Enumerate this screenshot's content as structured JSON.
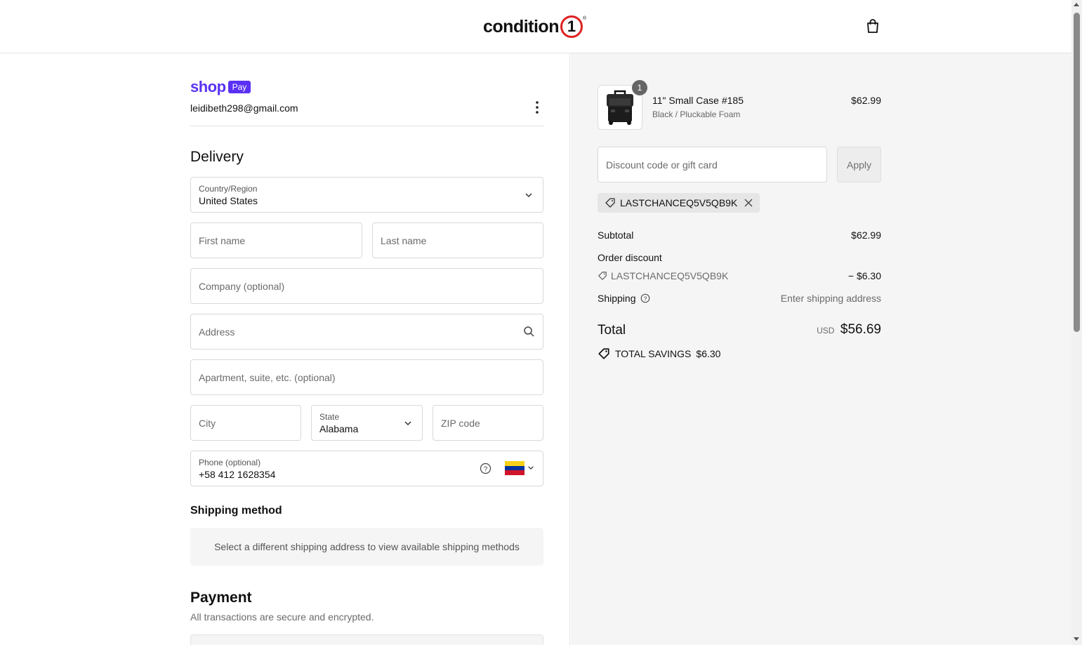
{
  "header": {
    "logo_text": "condition",
    "logo_number": "1",
    "logo_reg": "®",
    "cart_icon": "shopping-bag-icon"
  },
  "express": {
    "shop_word": "shop",
    "pay_badge": "Pay",
    "email": "leidibeth298@gmail.com",
    "menu_icon": "kebab-menu-icon"
  },
  "delivery": {
    "heading": "Delivery",
    "country_label": "Country/Region",
    "country_value": "United States",
    "first_name_placeholder": "First name",
    "last_name_placeholder": "Last name",
    "company_placeholder": "Company (optional)",
    "address_placeholder": "Address",
    "apartment_placeholder": "Apartment, suite, etc. (optional)",
    "city_placeholder": "City",
    "state_label": "State",
    "state_value": "Alabama",
    "zip_placeholder": "ZIP code",
    "phone_label": "Phone (optional)",
    "phone_value": "+58 412 1628354",
    "phone_country_flag": "venezuela-flag"
  },
  "shipping_method": {
    "heading": "Shipping method",
    "message": "Select a different shipping address to view available shipping methods"
  },
  "payment": {
    "heading": "Payment",
    "subtitle": "All transactions are secure and encrypted."
  },
  "summary": {
    "item": {
      "quantity": "1",
      "name": "11\" Small Case #185",
      "variant": "Black / Pluckable Foam",
      "price": "$62.99"
    },
    "discount_placeholder": "Discount code or gift card",
    "apply_label": "Apply",
    "applied_code": "LASTCHANCEQ5V5QB9K",
    "subtotal_label": "Subtotal",
    "subtotal_value": "$62.99",
    "order_discount_label": "Order discount",
    "discount_code": "LASTCHANCEQ5V5QB9K",
    "discount_value": "− $6.30",
    "shipping_label": "Shipping",
    "shipping_value": "Enter shipping address",
    "total_label": "Total",
    "total_currency": "USD",
    "total_value": "$56.69",
    "savings_label": "TOTAL SAVINGS",
    "savings_value": "$6.30"
  },
  "colors": {
    "shop_purple": "#5a31f4",
    "logo_red": "#dd2222",
    "summary_bg": "#f5f5f5"
  }
}
